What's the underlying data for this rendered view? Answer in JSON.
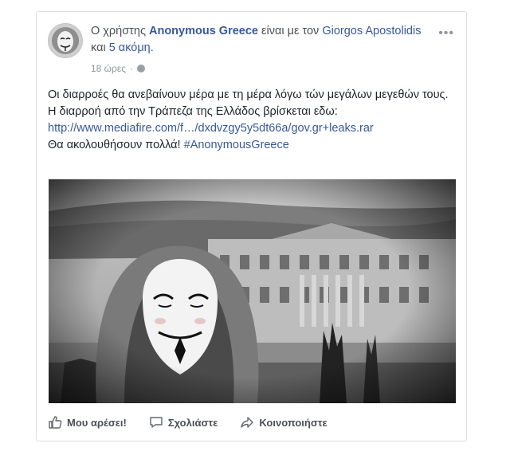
{
  "post": {
    "prefix": "Ο χρήστης",
    "author": "Anonymous Greece",
    "with_text": "είναι με τον",
    "tagged": "Giorgos Apostolidis",
    "and_text": "και",
    "others": "5 ακόμη",
    "end_dot": ".",
    "time": "18 ώρες",
    "sep": "·",
    "more": "•••",
    "lines": [
      "Οι διαρροές θα ανεβαίνουν μέρα με τη μέρα λόγω τών μεγάλων μεγεθών τους.",
      "Η διαρροή από την Τράπεζα της Ελλάδος βρίσκεται εδω:"
    ],
    "url": "http://www.mediafire.com/f…/dxdvzgy5y5dt66a/gov.gr+leaks.rar",
    "closing_text": "Θα ακολουθήσουν πολλά!",
    "hashtag": "#AnonymousGreece"
  },
  "actions": {
    "like": "Μου αρέσει!",
    "comment": "Σχολιάστε",
    "share": "Κοινοποιήστε"
  },
  "icons": {
    "avatar": "anonymous-mask-avatar",
    "privacy": "globe-icon",
    "like": "thumbs-up-icon",
    "comment": "comment-bubble-icon",
    "share": "share-arrow-icon"
  }
}
